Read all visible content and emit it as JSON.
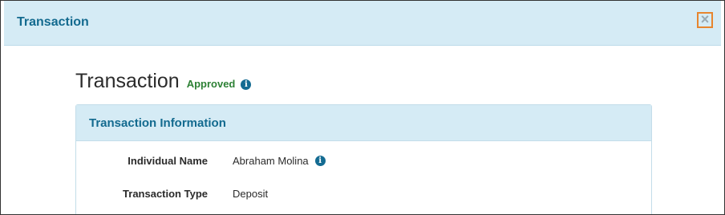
{
  "modal": {
    "title": "Transaction",
    "close_label": "×"
  },
  "page": {
    "title": "Transaction",
    "status": "Approved",
    "status_color": "#2d8135"
  },
  "panel": {
    "title": "Transaction Information",
    "fields": [
      {
        "label": "Individual Name",
        "value": "Abraham Molina",
        "has_info": true
      },
      {
        "label": "Transaction Type",
        "value": "Deposit",
        "has_info": false
      }
    ]
  },
  "icons": {
    "info": "i"
  },
  "colors": {
    "header_bg": "#d5ebf5",
    "title_text": "#136a8f",
    "close_focus_border": "#e7852e",
    "info_icon_bg": "#146b92"
  }
}
